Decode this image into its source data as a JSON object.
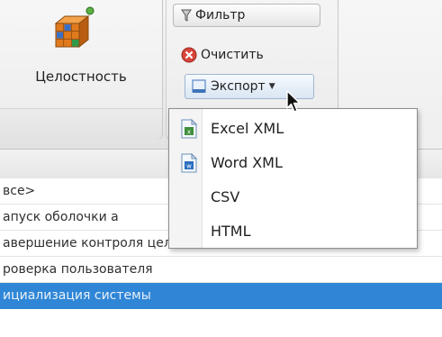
{
  "ribbon": {
    "integrity_label": "Целостность",
    "filter_label": "Фильтр",
    "clear_label": "Очистить",
    "export_label": "Экспорт"
  },
  "dropdown": {
    "items": [
      {
        "label": "Excel XML",
        "icon": "excel-xml-file-icon"
      },
      {
        "label": "Word XML",
        "icon": "word-xml-file-icon"
      },
      {
        "label": "CSV"
      },
      {
        "label": "HTML"
      }
    ]
  },
  "list": {
    "rows": [
      {
        "text": "все>"
      },
      {
        "text": "апуск оболочки а"
      },
      {
        "text": "авершение контроля целостности списка ..."
      },
      {
        "text": "роверка пользователя"
      },
      {
        "text": "ициализация системы",
        "selected": true
      }
    ]
  },
  "colors": {
    "selection": "#2f86d6",
    "clear_icon": "#d9443a",
    "excel_icon": "#3f8f3a",
    "word_icon": "#2a6fc0"
  }
}
